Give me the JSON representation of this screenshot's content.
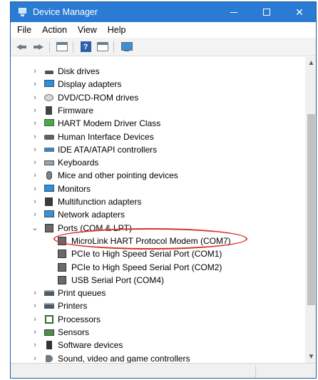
{
  "window": {
    "title": "Device Manager"
  },
  "title_controls": {
    "minimize": "—",
    "maximize": "☐",
    "close": "✕"
  },
  "menu": [
    {
      "label": "File"
    },
    {
      "label": "Action"
    },
    {
      "label": "View"
    },
    {
      "label": "Help"
    }
  ],
  "toolbar": {
    "help_glyph": "?"
  },
  "tree": {
    "expanded_chevron": "⌄",
    "collapsed_chevron": "›",
    "categories": [
      {
        "label": "Disk drives",
        "icon": "disk-drive-icon"
      },
      {
        "label": "Display adapters",
        "icon": "display-adapter-icon"
      },
      {
        "label": "DVD/CD-ROM drives",
        "icon": "dvd-drive-icon"
      },
      {
        "label": "Firmware",
        "icon": "firmware-icon"
      },
      {
        "label": "HART Modem Driver Class",
        "icon": "hart-modem-icon"
      },
      {
        "label": "Human Interface Devices",
        "icon": "hid-icon"
      },
      {
        "label": "IDE ATA/ATAPI controllers",
        "icon": "ide-controller-icon"
      },
      {
        "label": "Keyboards",
        "icon": "keyboard-icon"
      },
      {
        "label": "Mice and other pointing devices",
        "icon": "mouse-icon"
      },
      {
        "label": "Monitors",
        "icon": "monitor-icon"
      },
      {
        "label": "Multifunction adapters",
        "icon": "multifunction-adapter-icon"
      },
      {
        "label": "Network adapters",
        "icon": "network-adapter-icon"
      },
      {
        "label": "Ports (COM & LPT)",
        "icon": "port-icon",
        "expanded": true
      },
      {
        "label": "MicroLink HART Protocol Modem (COM7)",
        "icon": "serial-port-icon",
        "child": true
      },
      {
        "label": "PCIe to High Speed Serial Port (COM1)",
        "icon": "serial-port-icon",
        "child": true
      },
      {
        "label": "PCIe to High Speed Serial Port (COM2)",
        "icon": "serial-port-icon",
        "child": true
      },
      {
        "label": "USB Serial Port (COM4)",
        "icon": "serial-port-icon",
        "child": true
      },
      {
        "label": "Print queues",
        "icon": "print-queue-icon"
      },
      {
        "label": "Printers",
        "icon": "printer-icon"
      },
      {
        "label": "Processors",
        "icon": "processor-icon"
      },
      {
        "label": "Sensors",
        "icon": "sensor-icon"
      },
      {
        "label": "Software devices",
        "icon": "software-device-icon"
      },
      {
        "label": "Sound, video and game controllers",
        "icon": "sound-icon"
      }
    ]
  },
  "scrollbar": {
    "up": "▲",
    "down": "▼"
  },
  "colors": {
    "titlebar": "#2a7bd3",
    "highlight_ellipse": "#d9312b"
  }
}
